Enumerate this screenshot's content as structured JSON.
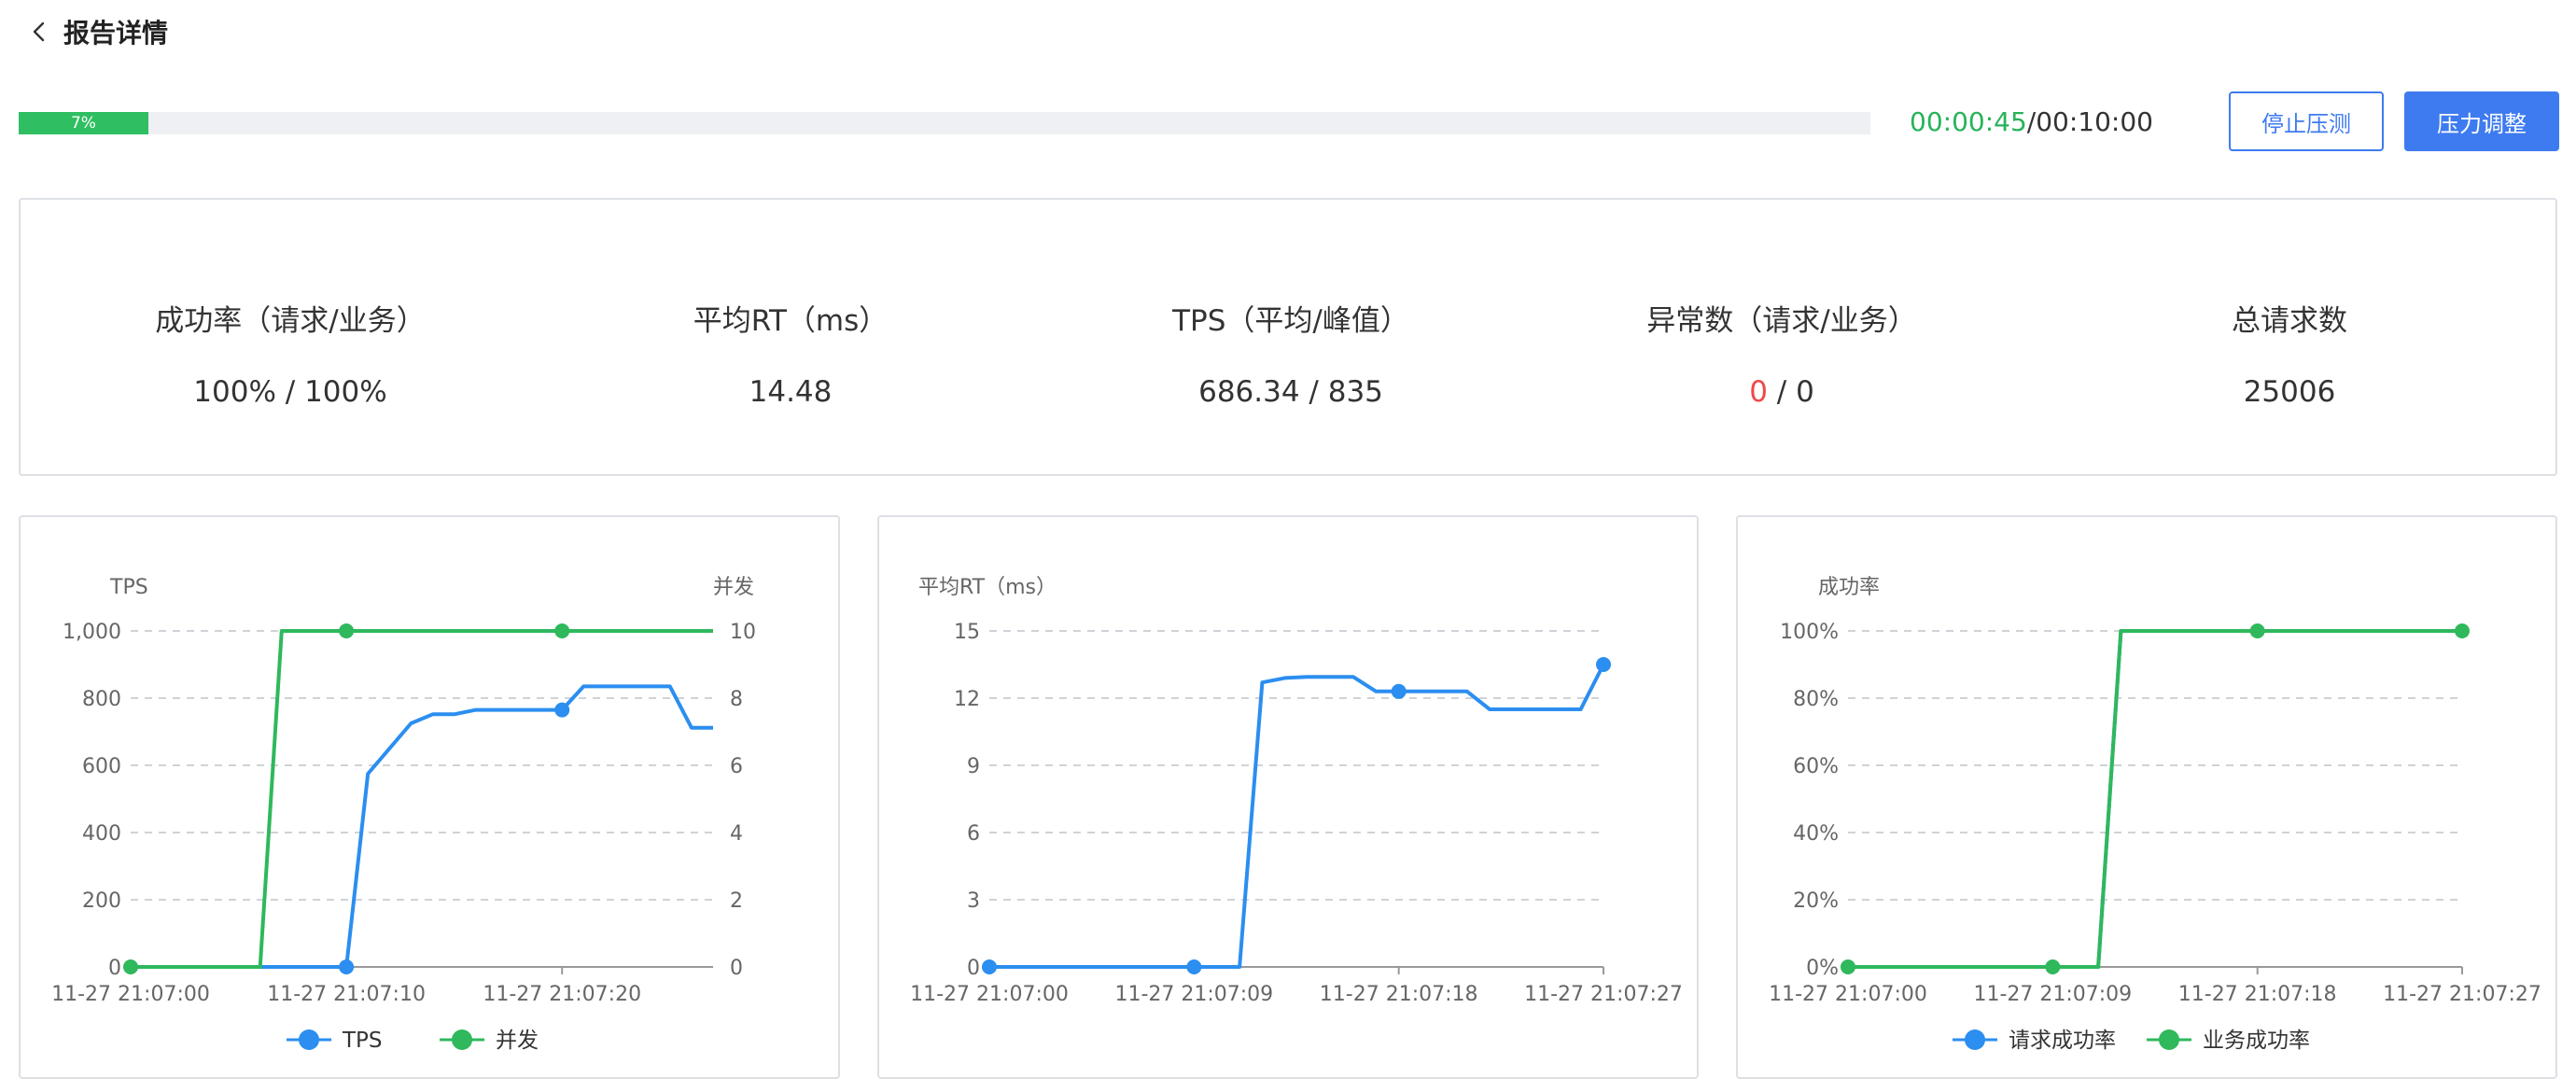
{
  "header": {
    "title": "报告详情",
    "back_icon": "chevron-left-icon"
  },
  "progress": {
    "percent": 7,
    "label": "7%",
    "elapsed": "00:00:45",
    "total": "/00:10:00"
  },
  "actions": {
    "stop_label": "停止压测",
    "adjust_label": "压力调整"
  },
  "colors": {
    "blue": "#2b8ef0",
    "green": "#2fb85c",
    "primary": "#3e7bf0",
    "danger": "#f04848"
  },
  "stats": [
    {
      "label": "成功率（请求/业务）",
      "value": "100% / 100%"
    },
    {
      "label": "平均RT（ms）",
      "value": "14.48"
    },
    {
      "label": "TPS（平均/峰值）",
      "value": "686.34 / 835"
    },
    {
      "label": "异常数（请求/业务）",
      "value_error": "0",
      "value_rest": " / 0"
    },
    {
      "label": "总请求数",
      "value": "25006"
    }
  ],
  "chart_data": [
    {
      "type": "line",
      "left_axis_title": "TPS",
      "right_axis_title": "并发",
      "ylim": [
        0,
        1000
      ],
      "y2lim": [
        0,
        10
      ],
      "yticks": [
        0,
        200,
        400,
        600,
        800,
        1000
      ],
      "yticklabels": [
        "0",
        "200",
        "400",
        "600",
        "800",
        "1,000"
      ],
      "y2ticks": [
        0,
        2,
        4,
        6,
        8,
        10
      ],
      "y2ticklabels": [
        "0",
        "2",
        "4",
        "6",
        "8",
        "10"
      ],
      "xlim": [
        0,
        27
      ],
      "xticks": [
        0,
        10,
        20
      ],
      "xticklabels": [
        "11-27 21:07:00",
        "11-27 21:07:10",
        "11-27 21:07:20"
      ],
      "grid": true,
      "legend_position": "bottom-center",
      "series": [
        {
          "name": "TPS",
          "color": "#2b8ef0",
          "axis": "left",
          "x": [
            0,
            10,
            11,
            12,
            13,
            14,
            15,
            16,
            17,
            18,
            19,
            20,
            21,
            22,
            23,
            24,
            25,
            26,
            27
          ],
          "y": [
            0,
            0,
            575,
            650,
            725,
            752,
            752,
            765,
            765,
            765,
            765,
            765,
            835,
            835,
            835,
            835,
            835,
            712,
            712
          ],
          "markers": [
            10,
            20
          ]
        },
        {
          "name": "并发",
          "color": "#2fb85c",
          "axis": "right",
          "x": [
            0,
            6,
            7,
            10,
            20,
            27
          ],
          "y": [
            0,
            0,
            10,
            10,
            10,
            10
          ],
          "markers": [
            0,
            10,
            20
          ]
        }
      ]
    },
    {
      "type": "line",
      "left_axis_title": "平均RT（ms）",
      "ylim": [
        0,
        15
      ],
      "yticks": [
        0,
        3,
        6,
        9,
        12,
        15
      ],
      "yticklabels": [
        "0",
        "3",
        "6",
        "9",
        "12",
        "15"
      ],
      "xlim": [
        0,
        27
      ],
      "xticks": [
        0,
        9,
        18,
        27
      ],
      "xticklabels": [
        "11-27 21:07:00",
        "11-27 21:07:09",
        "11-27 21:07:18",
        "11-27 21:07:27"
      ],
      "grid": true,
      "series": [
        {
          "name": "",
          "color": "#2b8ef0",
          "axis": "left",
          "x": [
            0,
            9,
            11,
            12,
            13,
            14,
            15,
            16,
            17,
            18,
            19,
            20,
            21,
            22,
            23,
            24,
            25,
            26,
            27
          ],
          "y": [
            0,
            0,
            0,
            12.7,
            12.9,
            12.95,
            12.95,
            12.95,
            12.3,
            12.3,
            12.3,
            12.3,
            12.3,
            11.5,
            11.5,
            11.5,
            11.5,
            11.5,
            13.5
          ],
          "markers": [
            0,
            9,
            18,
            27
          ]
        }
      ]
    },
    {
      "type": "line",
      "left_axis_title": "成功率",
      "ylim": [
        0,
        100
      ],
      "yticks": [
        0,
        20,
        40,
        60,
        80,
        100
      ],
      "yticklabels": [
        "0%",
        "20%",
        "40%",
        "60%",
        "80%",
        "100%"
      ],
      "xlim": [
        0,
        27
      ],
      "xticks": [
        0,
        9,
        18,
        27
      ],
      "xticklabels": [
        "11-27 21:07:00",
        "11-27 21:07:09",
        "11-27 21:07:18",
        "11-27 21:07:27"
      ],
      "grid": true,
      "legend_position": "bottom-center",
      "series": [
        {
          "name": "请求成功率",
          "color": "#2b8ef0",
          "axis": "left",
          "x": [
            0,
            11,
            12,
            27
          ],
          "y": [
            0,
            0,
            100,
            100
          ],
          "markers": []
        },
        {
          "name": "业务成功率",
          "color": "#2fb85c",
          "axis": "left",
          "x": [
            0,
            9,
            11,
            12,
            18,
            27
          ],
          "y": [
            0,
            0,
            0,
            100,
            100,
            100
          ],
          "markers": [
            0,
            9,
            18,
            27
          ]
        }
      ]
    }
  ]
}
